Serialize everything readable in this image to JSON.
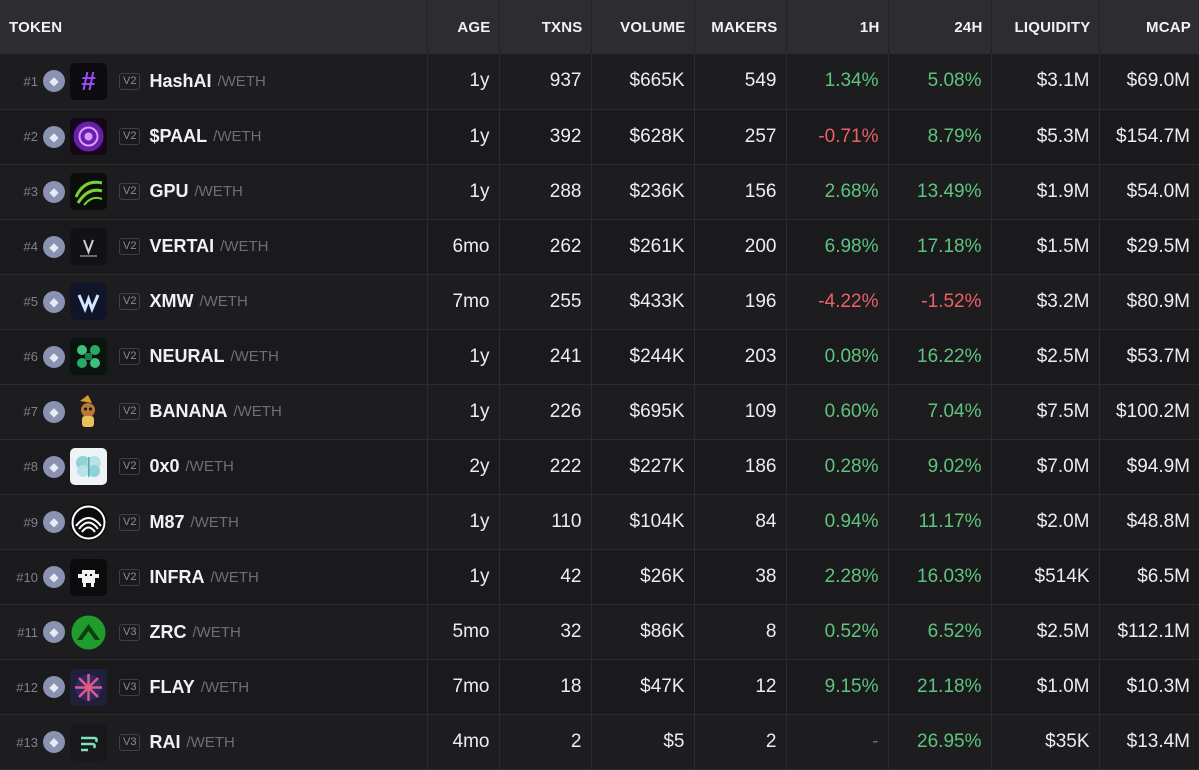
{
  "columns": [
    "TOKEN",
    "AGE",
    "TXNS",
    "VOLUME",
    "MAKERS",
    "1H",
    "24H",
    "LIQUIDITY",
    "MCAP"
  ],
  "quote": "/WETH",
  "chain_icon": "ethereum-icon",
  "colors": {
    "positive": "#5ec47d",
    "negative": "#ef5f66"
  },
  "rows": [
    {
      "rank": "#1",
      "ver": "V2",
      "symbol": "HashAI",
      "age": "1y",
      "txns": "937",
      "volume": "$665K",
      "makers": "549",
      "h1": "1.34%",
      "h1_dir": "pos",
      "h24": "5.08%",
      "h24_dir": "pos",
      "liquidity": "$3.1M",
      "mcap": "$69.0M",
      "logo": "hash-logo-icon"
    },
    {
      "rank": "#2",
      "ver": "V2",
      "symbol": "$PAAL",
      "age": "1y",
      "txns": "392",
      "volume": "$628K",
      "makers": "257",
      "h1": "-0.71%",
      "h1_dir": "neg",
      "h24": "8.79%",
      "h24_dir": "pos",
      "liquidity": "$5.3M",
      "mcap": "$154.7M",
      "logo": "paal-logo-icon"
    },
    {
      "rank": "#3",
      "ver": "V2",
      "symbol": "GPU",
      "age": "1y",
      "txns": "288",
      "volume": "$236K",
      "makers": "156",
      "h1": "2.68%",
      "h1_dir": "pos",
      "h24": "13.49%",
      "h24_dir": "pos",
      "liquidity": "$1.9M",
      "mcap": "$54.0M",
      "logo": "gpu-logo-icon"
    },
    {
      "rank": "#4",
      "ver": "V2",
      "symbol": "VERTAI",
      "age": "6mo",
      "txns": "262",
      "volume": "$261K",
      "makers": "200",
      "h1": "6.98%",
      "h1_dir": "pos",
      "h24": "17.18%",
      "h24_dir": "pos",
      "liquidity": "$1.5M",
      "mcap": "$29.5M",
      "logo": "vertai-logo-icon"
    },
    {
      "rank": "#5",
      "ver": "V2",
      "symbol": "XMW",
      "age": "7mo",
      "txns": "255",
      "volume": "$433K",
      "makers": "196",
      "h1": "-4.22%",
      "h1_dir": "neg",
      "h24": "-1.52%",
      "h24_dir": "neg",
      "liquidity": "$3.2M",
      "mcap": "$80.9M",
      "logo": "xmw-logo-icon"
    },
    {
      "rank": "#6",
      "ver": "V2",
      "symbol": "NEURAL",
      "age": "1y",
      "txns": "241",
      "volume": "$244K",
      "makers": "203",
      "h1": "0.08%",
      "h1_dir": "pos",
      "h24": "16.22%",
      "h24_dir": "pos",
      "liquidity": "$2.5M",
      "mcap": "$53.7M",
      "logo": "neural-logo-icon"
    },
    {
      "rank": "#7",
      "ver": "V2",
      "symbol": "BANANA",
      "age": "1y",
      "txns": "226",
      "volume": "$695K",
      "makers": "109",
      "h1": "0.60%",
      "h1_dir": "pos",
      "h24": "7.04%",
      "h24_dir": "pos",
      "liquidity": "$7.5M",
      "mcap": "$100.2M",
      "logo": "banana-logo-icon"
    },
    {
      "rank": "#8",
      "ver": "V2",
      "symbol": "0x0",
      "age": "2y",
      "txns": "222",
      "volume": "$227K",
      "makers": "186",
      "h1": "0.28%",
      "h1_dir": "pos",
      "h24": "9.02%",
      "h24_dir": "pos",
      "liquidity": "$7.0M",
      "mcap": "$94.9M",
      "logo": "brain-logo-icon"
    },
    {
      "rank": "#9",
      "ver": "V2",
      "symbol": "M87",
      "age": "1y",
      "txns": "110",
      "volume": "$104K",
      "makers": "84",
      "h1": "0.94%",
      "h1_dir": "pos",
      "h24": "11.17%",
      "h24_dir": "pos",
      "liquidity": "$2.0M",
      "mcap": "$48.8M",
      "logo": "m87-logo-icon"
    },
    {
      "rank": "#10",
      "ver": "V2",
      "symbol": "INFRA",
      "age": "1y",
      "txns": "42",
      "volume": "$26K",
      "makers": "38",
      "h1": "2.28%",
      "h1_dir": "pos",
      "h24": "16.03%",
      "h24_dir": "pos",
      "liquidity": "$514K",
      "mcap": "$6.5M",
      "logo": "infra-logo-icon"
    },
    {
      "rank": "#11",
      "ver": "V3",
      "symbol": "ZRC",
      "age": "5mo",
      "txns": "32",
      "volume": "$86K",
      "makers": "8",
      "h1": "0.52%",
      "h1_dir": "pos",
      "h24": "6.52%",
      "h24_dir": "pos",
      "liquidity": "$2.5M",
      "mcap": "$112.1M",
      "logo": "zrc-logo-icon"
    },
    {
      "rank": "#12",
      "ver": "V3",
      "symbol": "FLAY",
      "age": "7mo",
      "txns": "18",
      "volume": "$47K",
      "makers": "12",
      "h1": "9.15%",
      "h1_dir": "pos",
      "h24": "21.18%",
      "h24_dir": "pos",
      "liquidity": "$1.0M",
      "mcap": "$10.3M",
      "logo": "flay-logo-icon"
    },
    {
      "rank": "#13",
      "ver": "V3",
      "symbol": "RAI",
      "age": "4mo",
      "txns": "2",
      "volume": "$5",
      "makers": "2",
      "h1": "-",
      "h1_dir": "dash",
      "h24": "26.95%",
      "h24_dir": "pos",
      "liquidity": "$35K",
      "mcap": "$13.4M",
      "logo": "rai-logo-icon"
    }
  ]
}
